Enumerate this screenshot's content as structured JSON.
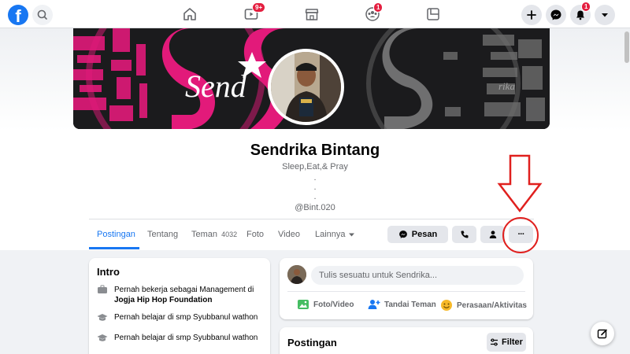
{
  "nav": {
    "logo": "f",
    "badges": {
      "watch": "9+",
      "groups": "1",
      "notifications": "1"
    }
  },
  "profile": {
    "cover_text": "Send",
    "name": "Sendrika Bintang",
    "bio_line1": "Sleep,Eat,& Pray",
    "bio_dot1": ".",
    "bio_dot2": ".",
    "bio_dot3": ".",
    "handle": "@Bint.020"
  },
  "tabs": [
    {
      "label": "Postingan"
    },
    {
      "label": "Tentang"
    },
    {
      "label": "Teman",
      "count": "4032"
    },
    {
      "label": "Foto"
    },
    {
      "label": "Video"
    },
    {
      "label": "Lainnya"
    }
  ],
  "actions": {
    "message": "Pesan",
    "more": "···"
  },
  "intro": {
    "title": "Intro",
    "work_prefix": "Pernah bekerja sebagai Management di",
    "work_place": "Jogja Hip Hop Foundation",
    "edu1": "Pernah belajar di smp Syubbanul wathon",
    "edu2": "Pernah belajar di smp Syubbanul wathon"
  },
  "composer": {
    "placeholder": "Tulis sesuatu untuk Sendrika...",
    "photo_video": "Foto/Video",
    "tag_friends": "Tandai Teman",
    "feeling": "Perasaan/Aktivitas"
  },
  "posts": {
    "title": "Postingan",
    "filter": "Filter"
  },
  "colors": {
    "brand": "#1877f2",
    "annotation": "#e0201e",
    "badge": "#e41e3f"
  }
}
